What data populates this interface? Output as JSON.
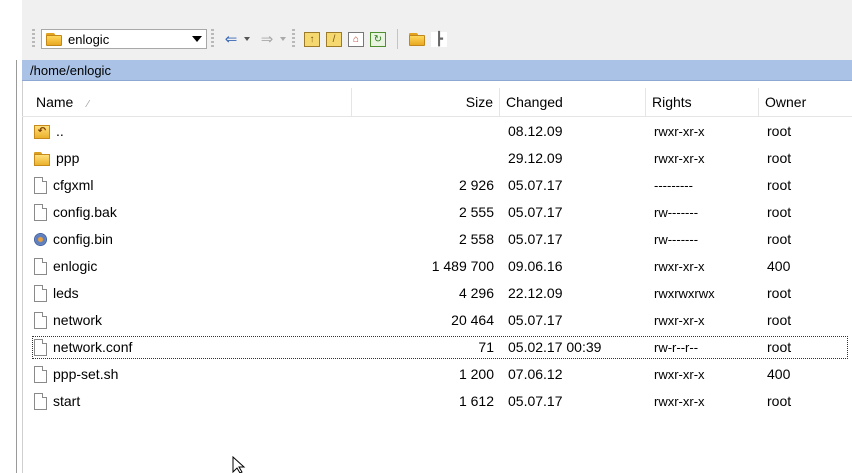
{
  "toolbar": {
    "location_combo_value": "enlogic",
    "icons": [
      "back-arrow-icon",
      "forward-arrow-icon",
      "parent-folder-icon",
      "root-folder-icon",
      "home-icon",
      "refresh-icon",
      "open-folder-icon",
      "tree-icon"
    ]
  },
  "address": {
    "path": "/home/enlogic"
  },
  "columns": {
    "name": "Name",
    "size": "Size",
    "changed": "Changed",
    "rights": "Rights",
    "owner": "Owner"
  },
  "rows": [
    {
      "icon": "parent-dir-icon",
      "name": "..",
      "size": "",
      "changed": "08.12.09",
      "rights": "rwxr-xr-x",
      "owner": "root"
    },
    {
      "icon": "folder-icon",
      "name": "ppp",
      "size": "",
      "changed": "29.12.09",
      "rights": "rwxr-xr-x",
      "owner": "root"
    },
    {
      "icon": "file-icon",
      "name": "cfgxml",
      "size": "2 926",
      "changed": "05.07.17",
      "rights": "---------",
      "owner": "root"
    },
    {
      "icon": "file-icon",
      "name": "config.bak",
      "size": "2 555",
      "changed": "05.07.17",
      "rights": "rw-------",
      "owner": "root"
    },
    {
      "icon": "binary-file-icon",
      "name": "config.bin",
      "size": "2 558",
      "changed": "05.07.17",
      "rights": "rw-------",
      "owner": "root"
    },
    {
      "icon": "file-icon",
      "name": "enlogic",
      "size": "1 489 700",
      "changed": "09.06.16",
      "rights": "rwxr-xr-x",
      "owner": "400"
    },
    {
      "icon": "file-icon",
      "name": "leds",
      "size": "4 296",
      "changed": "22.12.09",
      "rights": "rwxrwxrwx",
      "owner": "root"
    },
    {
      "icon": "file-icon",
      "name": "network",
      "size": "20 464",
      "changed": "05.07.17",
      "rights": "rwxr-xr-x",
      "owner": "root"
    },
    {
      "icon": "file-icon",
      "name": "network.conf",
      "size": "71",
      "changed": "05.02.17 00:39",
      "rights": "rw-r--r--",
      "owner": "root"
    },
    {
      "icon": "file-icon",
      "name": "ppp-set.sh",
      "size": "1 200",
      "changed": "07.06.12",
      "rights": "rwxr-xr-x",
      "owner": "400"
    },
    {
      "icon": "file-icon",
      "name": "start",
      "size": "1 612",
      "changed": "05.07.17",
      "rights": "rwxr-xr-x",
      "owner": "root"
    }
  ]
}
